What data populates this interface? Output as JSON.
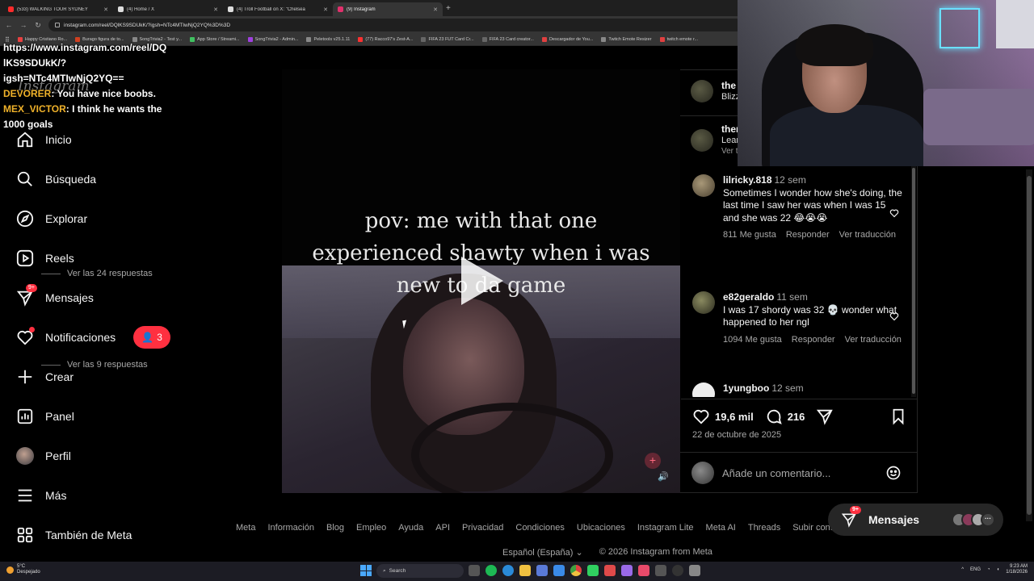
{
  "browser": {
    "tabs": [
      {
        "label": "(533) WALKING TOUR SYDNEY",
        "color": "#ff2b2b",
        "active": false
      },
      {
        "label": "(4) Home / X",
        "color": "#dddddd",
        "active": false
      },
      {
        "label": "(4) Troll Football on X: \"Chelsea",
        "color": "#dddddd",
        "active": false
      },
      {
        "label": "(9) Instagram",
        "color": "#e1306c",
        "active": true
      }
    ],
    "url": "instagram.com/reel/DQlKS9SDUkK/?igsh=NTc4MTIwNjQ2YQ%3D%3D",
    "bookmarks": [
      {
        "label": "Happy Cristiano Ro...",
        "color": "#e84040"
      },
      {
        "label": "Burago figura de to...",
        "color": "#d04020"
      },
      {
        "label": "SongTrivia2 - Test y...",
        "color": "#888888"
      },
      {
        "label": "App Store / Streami...",
        "color": "#40c060"
      },
      {
        "label": "SongTrivia2 - Admin...",
        "color": "#a040e0"
      },
      {
        "label": "Peletools v25.1.11",
        "color": "#888888"
      },
      {
        "label": "(77) Racco97's Zest-A...",
        "color": "#ff3030"
      },
      {
        "label": "FIFA 23 FUT Card Cr...",
        "color": "#666666"
      },
      {
        "label": "FIFA 23 Card creator...",
        "color": "#666666"
      },
      {
        "label": "Descargador de You...",
        "color": "#e04040"
      },
      {
        "label": "Twitch Emote Resizer",
        "color": "#888888"
      },
      {
        "label": "twitch emote r...",
        "color": "#e04040"
      }
    ]
  },
  "chat": {
    "link_lines": [
      "https://www.instagram.com/reel/DQ",
      "lKS9SDUkK/?",
      "igsh=NTc4MTIwNjQ2YQ=="
    ],
    "messages": [
      {
        "user": "DEVORER",
        "text": ": You have nice boobs."
      },
      {
        "user": "MEX_VICTOR",
        "text": ": I think he wants the 1000 goals"
      }
    ]
  },
  "sidebar": {
    "logo": "Instagram",
    "items": [
      {
        "label": "Inicio",
        "icon": "home-icon"
      },
      {
        "label": "Búsqueda",
        "icon": "search-icon"
      },
      {
        "label": "Explorar",
        "icon": "compass-icon"
      },
      {
        "label": "Reels",
        "icon": "reels-icon"
      },
      {
        "label": "Mensajes",
        "icon": "messenger-icon",
        "badge": "9+"
      },
      {
        "label": "Notificaciones",
        "icon": "heart-icon",
        "pill": "3"
      },
      {
        "label": "Crear",
        "icon": "plus-icon"
      },
      {
        "label": "Panel",
        "icon": "chart-icon"
      },
      {
        "label": "Perfil",
        "icon": "profile-avatar"
      },
      {
        "label": "Más",
        "icon": "menu-icon"
      },
      {
        "label": "También de Meta",
        "icon": "meta-grid-icon"
      }
    ]
  },
  "reel": {
    "caption_lines": [
      "pov: me with that one",
      "experienced shawty when i was",
      "new to da game"
    ]
  },
  "panel": {
    "header": [
      {
        "name": "the",
        "sub": "Blizz"
      },
      {
        "name": "ther",
        "sub": "Lear",
        "sub2": "Ver t"
      }
    ],
    "comments": [
      {
        "user": "lilricky.818",
        "time": "12 sem",
        "text": "Sometimes I wonder how she's doing, the last time I saw her was when I was 15 and she was 22 😂😭😭",
        "likes": "811 Me gusta",
        "reply": "Responder",
        "translate": "Ver traducción",
        "replies": "Ver las 24 respuestas"
      },
      {
        "user": "e82geraldo",
        "time": "11 sem",
        "text": "I was 17 shordy was 32 💀 wonder what happened to her ngl",
        "likes": "1094 Me gusta",
        "reply": "Responder",
        "translate": "Ver traducción",
        "replies": "Ver las 9 respuestas"
      },
      {
        "user": "1yungboo",
        "time": "12 sem",
        "text": ""
      }
    ],
    "likes_count": "19,6 mil",
    "comments_count": "216",
    "date": "22 de octubre de 2025",
    "comment_placeholder": "Añade un comentario..."
  },
  "footer": {
    "links": [
      "Meta",
      "Información",
      "Blog",
      "Empleo",
      "Ayuda",
      "API",
      "Privacidad",
      "Condiciones",
      "Ubicaciones",
      "Instagram Lite",
      "Meta AI",
      "Threads",
      "Subir contactos y p"
    ],
    "language": "Español (España)",
    "copyright": "© 2026 Instagram from Meta"
  },
  "messages_float": {
    "label": "Mensajes",
    "badge": "9+"
  },
  "taskbar": {
    "weather_temp": "5°C",
    "weather_desc": "Despejado",
    "search": "Search",
    "lang": "ENG",
    "time": "9:23 AM",
    "date": "1/18/2026"
  }
}
